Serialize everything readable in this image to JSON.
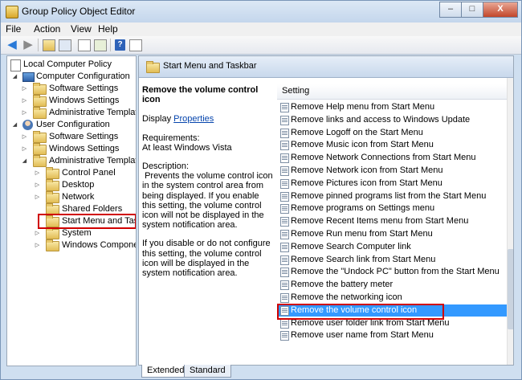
{
  "window": {
    "title": "Group Policy Object Editor",
    "minimize": "–",
    "maximize": "□",
    "close": "X"
  },
  "menu": [
    "File",
    "Action",
    "View",
    "Help"
  ],
  "toolbar": {
    "icons": [
      "back-arrow",
      "forward-arrow",
      "up-folder",
      "show-tree",
      "properties",
      "export",
      "help"
    ],
    "help_label": "?"
  },
  "tree": {
    "items": [
      {
        "label": "Local Computer Policy",
        "icon": "doc-icon"
      },
      {
        "label": "Computer Configuration",
        "icon": "pc-icon"
      },
      {
        "label": "Software Settings",
        "icon": "folder-icon"
      },
      {
        "label": "Windows Settings",
        "icon": "folder-icon"
      },
      {
        "label": "Administrative Templates",
        "icon": "folder-icon"
      },
      {
        "label": "User Configuration",
        "icon": "user-icon"
      },
      {
        "label": "Software Settings",
        "icon": "folder-icon"
      },
      {
        "label": "Windows Settings",
        "icon": "folder-icon"
      },
      {
        "label": "Administrative Templates",
        "icon": "folder-icon"
      },
      {
        "label": "Control Panel",
        "icon": "folder-icon"
      },
      {
        "label": "Desktop",
        "icon": "folder-icon"
      },
      {
        "label": "Network",
        "icon": "folder-icon"
      },
      {
        "label": "Shared Folders",
        "icon": "folder-icon"
      },
      {
        "label": "Start Menu and Taskbar",
        "icon": "folder-icon"
      },
      {
        "label": "System",
        "icon": "folder-icon"
      },
      {
        "label": "Windows Components",
        "icon": "folder-icon"
      }
    ]
  },
  "right": {
    "header_title": "Start Menu and Taskbar",
    "desc_title": "Remove the volume control icon",
    "display_label": "Display",
    "properties_link": "Properties",
    "requirements_label": "Requirements:",
    "requirements_value": "At least Windows Vista",
    "description_label": "Description:",
    "description_text": " Prevents the volume control icon in the system control area from being displayed. If you enable this setting, the volume control icon will not be displayed in the system notification area.",
    "description_text2": "If you disable or do not configure this setting, the volume control icon will be displayed in the system notification area.",
    "column_header": "Setting",
    "settings": [
      "Remove Help menu from Start Menu",
      "Remove links and access to Windows Update",
      "Remove Logoff on the Start Menu",
      "Remove Music icon from Start Menu",
      "Remove Network Connections from Start Menu",
      "Remove Network icon from Start Menu",
      "Remove Pictures icon from Start Menu",
      "Remove pinned programs list from the Start Menu",
      "Remove programs on Settings menu",
      "Remove Recent Items menu from Start Menu",
      "Remove Run menu from Start Menu",
      "Remove Search Computer link",
      "Remove Search link from Start Menu",
      "Remove the \"Undock PC\" button from the Start Menu",
      "Remove the battery meter",
      "Remove the networking icon",
      "Remove the volume control icon",
      "Remove user folder link from Start Menu",
      "Remove user name from Start Menu"
    ],
    "selected_setting": "Remove the volume control icon"
  },
  "tabs": [
    "Extended",
    "Standard"
  ],
  "colors": {
    "selection": "#3399ff",
    "highlight_box": "#d00000",
    "link": "#0645ad"
  }
}
